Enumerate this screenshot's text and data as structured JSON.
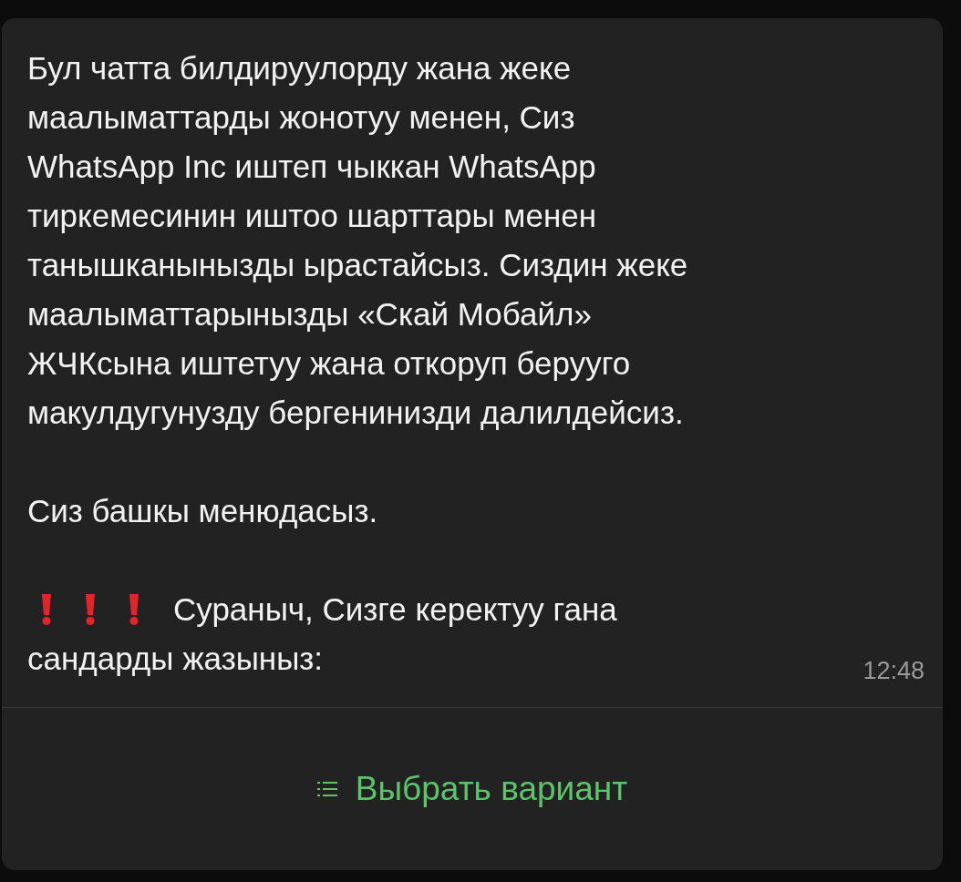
{
  "message": {
    "paragraphs": [
      "Бул чатта билдируулорду жана жеке\nмаалыматтарды жонотуу менен, Сиз\nWhatsApp Inc иштеп чыккан WhatsApp\nтиркемесинин иштоо шарттары менен\nтанышканынызды ырастайсыз. Сиздин жеке\nмаалыматтарынызды «Скай Мобайл»\nЖЧКсына иштетуу жана откоруп берууго\nмакулдугунузду бергенинизди далилдейсиз.",
      "Сиз башкы менюдасыз."
    ],
    "prompt_lines": [
      "Сураныч, Сизге керектуу гана",
      "сандарды жазыныз:"
    ],
    "time": "12:48"
  },
  "button": {
    "label": "Выбрать вариант"
  }
}
